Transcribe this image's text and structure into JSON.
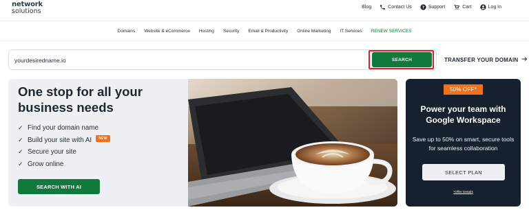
{
  "header": {
    "logo_line1": "network",
    "logo_line2": "solutions",
    "top_links": {
      "blog": "Blog",
      "contact": "Contact Us",
      "support": "Support",
      "cart": "Cart",
      "login": "Log In"
    }
  },
  "main_nav": {
    "items": [
      "Domains",
      "Website & eCommerce",
      "Hosting",
      "Security",
      "Email & Productivity",
      "Online Marketing",
      "IT Services"
    ],
    "renew": "RENEW SERVICES"
  },
  "search": {
    "value": "yourdesiredname.io",
    "button": "SEARCH",
    "transfer": "TRANSFER YOUR DOMAIN"
  },
  "hero": {
    "title": "One stop for all your business needs",
    "features": [
      "Find your domain name",
      "Build your site with AI",
      "Secure your site",
      "Grow online"
    ],
    "new_badge": "NEW",
    "button": "SEARCH WITH AI"
  },
  "promo": {
    "badge": "50% OFF*",
    "title": "Power your team with Google Workspace",
    "description": "Save up to 50% on smart, secure tools for seamless collaboration",
    "button": "SELECT PLAN",
    "offer_link": "*Offer Details"
  },
  "colors": {
    "brand_green": "#0f7a3b",
    "promo_bg": "#16202e",
    "badge_orange": "#f2711c",
    "highlight_red": "#e0202a"
  }
}
